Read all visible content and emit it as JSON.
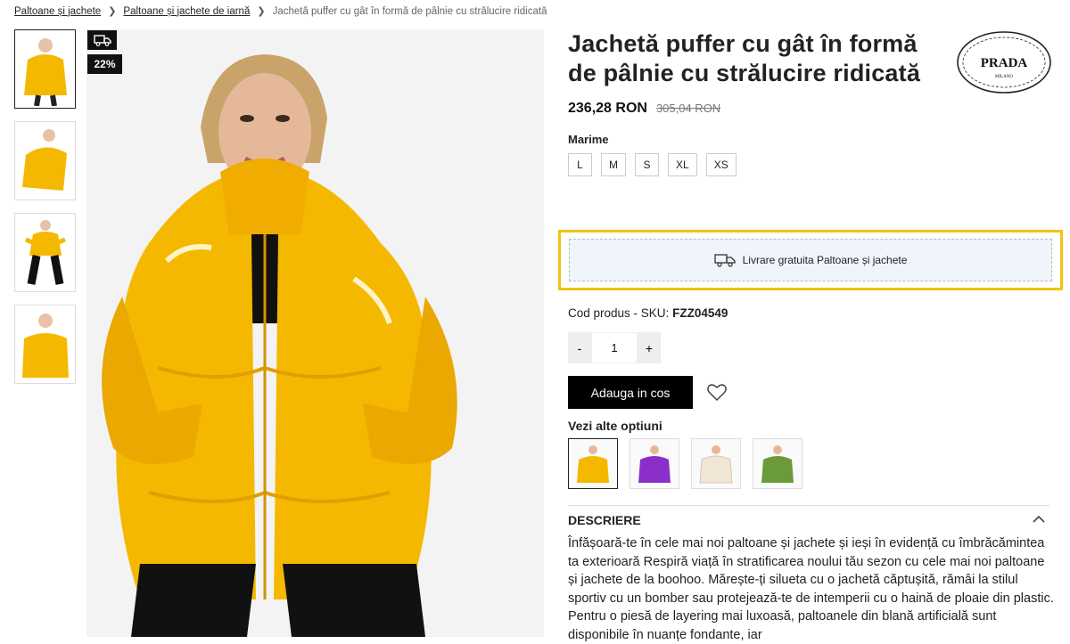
{
  "breadcrumb": {
    "items": [
      "Paltoane și jachete",
      "Paltoane și jachete de iarnă"
    ],
    "current": "Jachetă puffer cu gât în formă de pâlnie cu strălucire ridicată"
  },
  "product": {
    "title": "Jachetă puffer cu gât în formă de pâlnie cu strălucire ridicată",
    "price": "236,28 RON",
    "old_price": "305,04 RON",
    "discount_badge": "22%",
    "brand_logo_text": "PRADA",
    "brand_logo_subtext": "MILANO",
    "size_label": "Marime",
    "sizes": [
      "L",
      "M",
      "S",
      "XL",
      "XS"
    ],
    "shipping_text": "Livrare gratuita Paltoane și jachete",
    "sku_label": "Cod produs - SKU:",
    "sku_value": "FZZ04549",
    "quantity": "1",
    "qty_minus": "-",
    "qty_plus": "+",
    "add_to_cart": "Adauga in cos",
    "options_label": "Vezi alte optiuni",
    "description_title": "DESCRIERE",
    "description_text": "Înfășoară-te în cele mai noi paltoane și jachete și ieși în evidență cu îmbrăcămintea ta exterioară Respiră viață în stratificarea noului tău sezon cu cele mai noi paltoane și jachete de la boohoo. Mărește-ți silueta cu o jachetă căptușită, rămâi la stilul sportiv cu un bomber sau protejează-te de intemperii cu o haină de ploaie din plastic. Pentru o piesă de layering mai luxoasă, paltoanele din blană artificială sunt disponibile în nuanțe fondante, iar"
  },
  "colors": {
    "jacket": "#f5b800",
    "highlight": "#f1c40f",
    "shipping_bg": "#f0f4fb",
    "option_colors": [
      "#f5b800",
      "#8a2fc9",
      "#f1e6d6",
      "#6a9a3a"
    ]
  }
}
